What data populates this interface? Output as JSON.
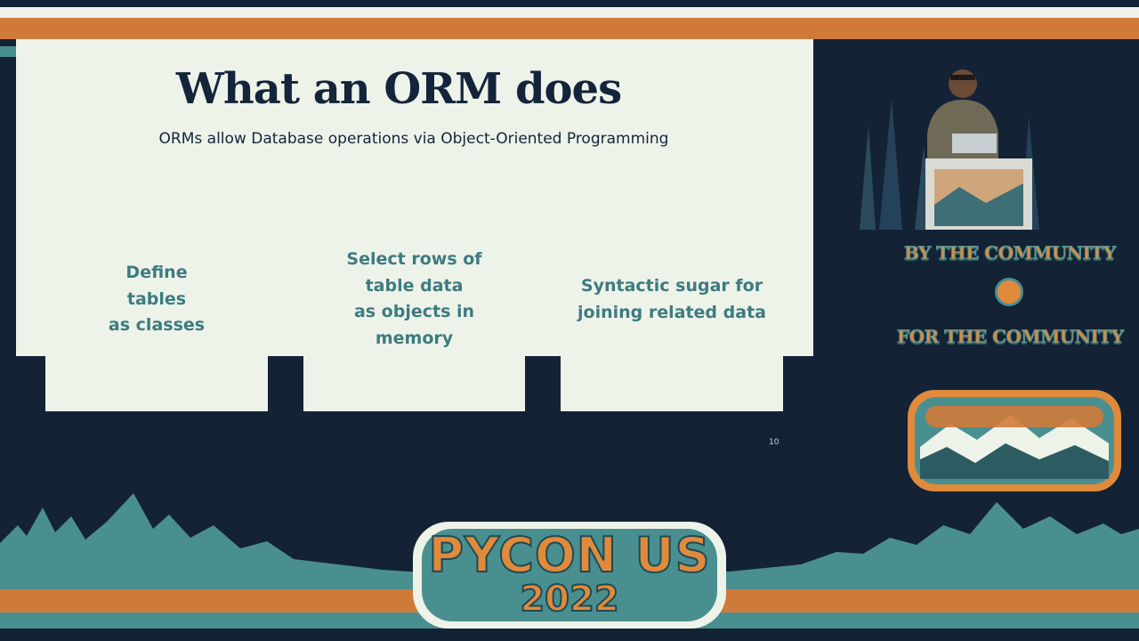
{
  "slide": {
    "title": "What an ORM does",
    "subtitle": "ORMs allow Database operations via Object-Oriented Programming",
    "columns": [
      {
        "text": "Define\ntables\nas classes"
      },
      {
        "text": "Select rows of\ntable data\nas objects in\nmemory"
      },
      {
        "text": "Syntactic sugar for\njoining related data"
      }
    ],
    "page_number": "10"
  },
  "branding": {
    "tagline_top": "BY THE COMMUNITY",
    "tagline_bottom": "FOR THE COMMUNITY",
    "event_name": "PYCON US",
    "event_year": "2022"
  },
  "colors": {
    "background": "#142236",
    "slide_bg": "#eef3e9",
    "title": "#13243b",
    "body_text": "#3d7b81",
    "accent_orange": "#e08a3c",
    "accent_teal": "#4a8f90"
  }
}
